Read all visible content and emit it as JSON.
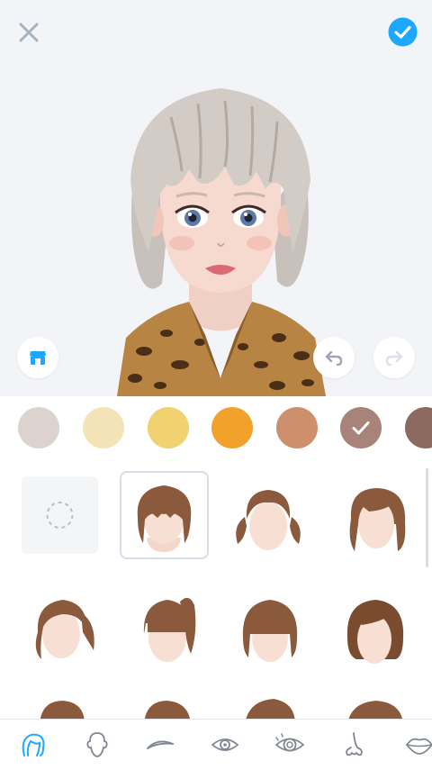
{
  "toolbar": {
    "close_icon": "close-icon",
    "confirm_icon": "check-circle-icon",
    "confirm_color": "#1ea7ff"
  },
  "preview_controls": {
    "store_icon": "store-icon",
    "undo_icon": "undo-icon",
    "redo_icon": "redo-icon",
    "redo_enabled": false
  },
  "hair_colors": {
    "selected_index": 5,
    "swatches": [
      "#dcd3cf",
      "#f3e3b6",
      "#f1d170",
      "#f2a22a",
      "#cd8f6c",
      "#a78379",
      "#8d6a5f"
    ]
  },
  "hair_styles": {
    "selected_index": 1,
    "items": [
      "none",
      "short-bob-bangs",
      "pigtails",
      "long-side-part",
      "side-ponytail",
      "ponytail-bangs",
      "bob-bangs",
      "sleek-bob"
    ]
  },
  "tabs": {
    "active_index": 0,
    "active_color": "#1ea7ff",
    "items": [
      "hair-icon",
      "face-shape-icon",
      "eyebrow-icon",
      "eye-icon",
      "eye-detail-icon",
      "nose-icon",
      "lips-icon"
    ]
  }
}
